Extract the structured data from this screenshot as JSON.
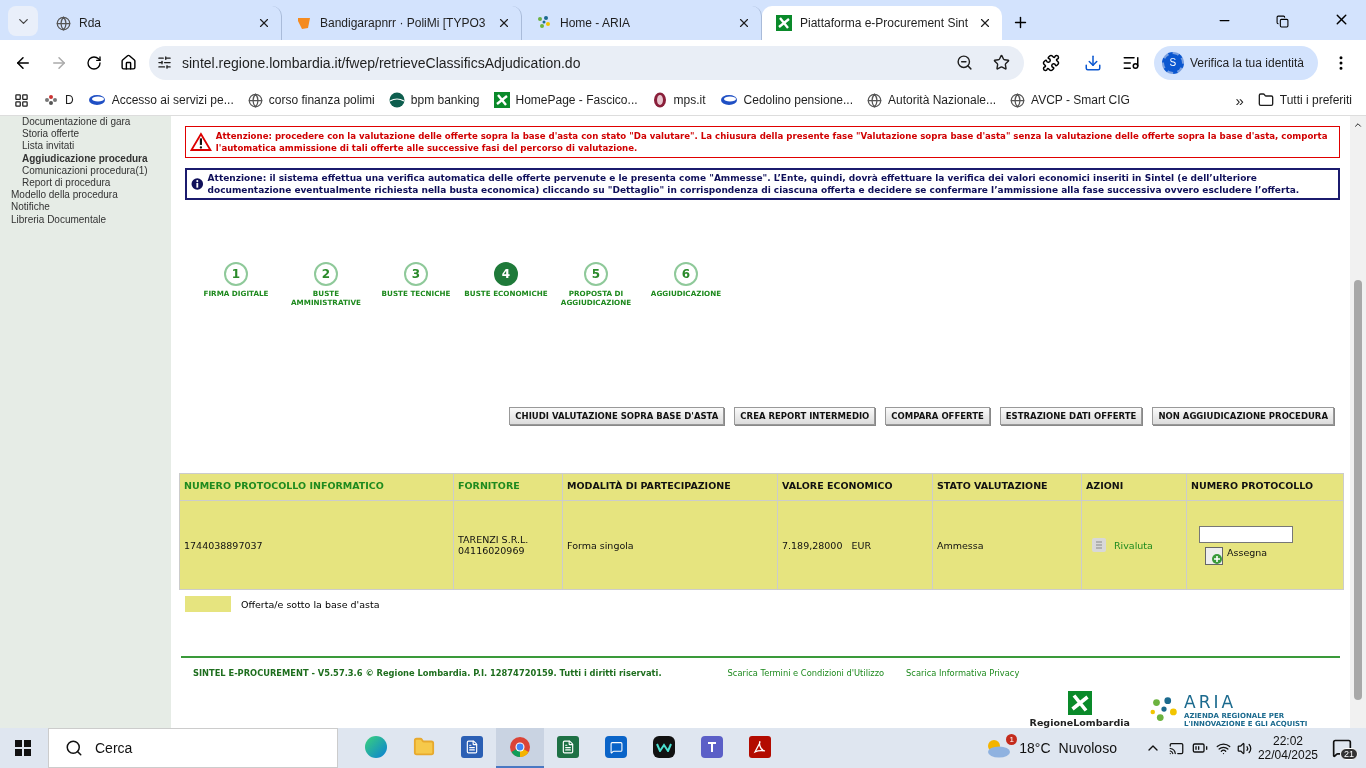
{
  "browser": {
    "tabs": [
      {
        "title": "Rda",
        "kind": "globe",
        "selected": false
      },
      {
        "title": "Bandigarapnrr · PoliMi [TYPO3",
        "kind": "typo3",
        "selected": false
      },
      {
        "title": "Home - ARIA",
        "kind": "aria",
        "selected": false
      },
      {
        "title": "Piattaforma e-Procurement Sint",
        "kind": "lombardia",
        "selected": true
      }
    ],
    "url": "sintel.regione.lombardia.it/fwep/retrieveClassificsAdjudication.do",
    "profile_button": {
      "initial": "S",
      "label": "Verifica la tua identità"
    },
    "bookmarks": [
      {
        "label": "D",
        "kind": "dots"
      },
      {
        "label": "Accesso ai servizi pe...",
        "kind": "oval"
      },
      {
        "label": "corso finanza polimi",
        "kind": "globe"
      },
      {
        "label": "bpm banking",
        "kind": "bpm"
      },
      {
        "label": "HomePage - Fascico...",
        "kind": "lombardia"
      },
      {
        "label": "mps.it",
        "kind": "mps"
      },
      {
        "label": "Cedolino pensione...",
        "kind": "oval"
      },
      {
        "label": "Autorità Nazionale...",
        "kind": "globe"
      },
      {
        "label": "AVCP - Smart CIG",
        "kind": "globe"
      }
    ],
    "more_bookmarks": "»",
    "all_bookmarks": "Tutti i preferiti"
  },
  "sidebar": {
    "items": [
      {
        "label": "Documentazione di gara",
        "selected": false
      },
      {
        "label": "Storia offerte",
        "selected": false
      },
      {
        "label": "Lista invitati",
        "selected": false
      },
      {
        "label": "Aggiudicazione procedura",
        "selected": true
      },
      {
        "label": "Comunicazioni procedura(1)",
        "selected": false
      },
      {
        "label": "Report di procedura",
        "selected": false
      }
    ],
    "top_items": [
      "Modello della procedura",
      "Notifiche",
      "Libreria Documentale"
    ]
  },
  "alerts": [
    {
      "kind": "warning",
      "text": "Attenzione: procedere con la valutazione delle offerte sopra la base d'asta con stato \"Da valutare\". La chiusura della presente fase \"Valutazione sopra base d'asta\" senza la valutazione delle offerte sopra la base d'asta, comporta l'automatica ammissione di tali offerte alle successive fasi del percorso di valutazione."
    },
    {
      "kind": "info",
      "text": "Attenzione: il sistema effettua una verifica automatica delle offerte pervenute e le presenta come \"Ammesse\". L’Ente, quindi, dovrà effettuare la verifica dei valori economici inseriti in Sintel (e dell’ulteriore documentazione eventualmente richiesta nella busta economica) cliccando su \"Dettaglio\" in corrispondenza di ciascuna offerta e decidere se confermare l’ammissione alla fase successiva ovvero escludere l’offerta."
    }
  ],
  "steps": [
    {
      "number": "1",
      "label": "FIRMA DIGITALE",
      "selected": false
    },
    {
      "number": "2",
      "label": "BUSTE AMMINISTRATIVE",
      "selected": false
    },
    {
      "number": "3",
      "label": "BUSTE TECNICHE",
      "selected": false
    },
    {
      "number": "4",
      "label": "BUSTE ECONOMICHE",
      "selected": true
    },
    {
      "number": "5",
      "label": "PROPOSTA DI AGGIUDICAZIONE",
      "selected": false
    },
    {
      "number": "6",
      "label": "AGGIUDICAZIONE",
      "selected": false
    }
  ],
  "actions": [
    "CHIUDI VALUTAZIONE SOPRA BASE D'ASTA",
    "CREA REPORT INTERMEDIO",
    "COMPARA OFFERTE",
    "ESTRAZIONE DATI OFFERTE",
    "NON AGGIUDICAZIONE PROCEDURA"
  ],
  "table": {
    "columns": [
      {
        "label": "NUMERO PROTOCOLLO INFORMATICO",
        "sortable": true
      },
      {
        "label": "FORNITORE",
        "sortable": true
      },
      {
        "label": "MODALITÀ DI PARTECIPAZIONE",
        "sortable": false
      },
      {
        "label": "VALORE ECONOMICO",
        "sortable": false
      },
      {
        "label": "STATO VALUTAZIONE",
        "sortable": false
      },
      {
        "label": "AZIONI",
        "sortable": false
      },
      {
        "label": "NUMERO PROTOCOLLO",
        "sortable": false
      }
    ],
    "rows": [
      {
        "color": "#e6e47f",
        "protocol": "1744038897037",
        "supplier": [
          "TARENZI S.R.L.",
          "04116020969"
        ],
        "mode": "Forma singola",
        "value": "7.189,28000",
        "currency": "EUR",
        "status": "Ammessa",
        "action": "Rivaluta",
        "assign": "Assegna"
      }
    ]
  },
  "legend": [
    {
      "color": "#e6e47f",
      "label": "Offerta/e sotto la base d'asta"
    }
  ],
  "footer": {
    "copyright": "SINTEL E-PROCUREMENT - V5.57.3.6 © Regione Lombardia. P.I. 12874720159. Tutti i diritti riservati.",
    "links": [
      "Scarica Termini e Condizioni d'Utilizzo",
      "Scarica Informativa Privacy"
    ],
    "region_logo": "RegioneLombardia",
    "aria_logo": {
      "name": "ARIA",
      "tagline": "AZIENDA REGIONALE PER L'INNOVAZIONE E GLI ACQUISTI"
    }
  },
  "taskbar": {
    "search_placeholder": "Cerca",
    "apps": [
      {
        "kind": "edge",
        "selected": false
      },
      {
        "kind": "folder",
        "selected": false
      },
      {
        "kind": "word",
        "selected": false
      },
      {
        "kind": "chrome",
        "selected": true
      },
      {
        "kind": "excel",
        "selected": false
      },
      {
        "kind": "outlook",
        "selected": false
      },
      {
        "kind": "webex",
        "selected": false
      },
      {
        "kind": "teams",
        "selected": false
      },
      {
        "kind": "acrobat",
        "selected": false
      }
    ],
    "weather": {
      "badge": "1",
      "temperature": "18°C",
      "condition": "Nuvoloso"
    },
    "time": "22:02",
    "date": "22/04/2025",
    "notifications": "21"
  }
}
